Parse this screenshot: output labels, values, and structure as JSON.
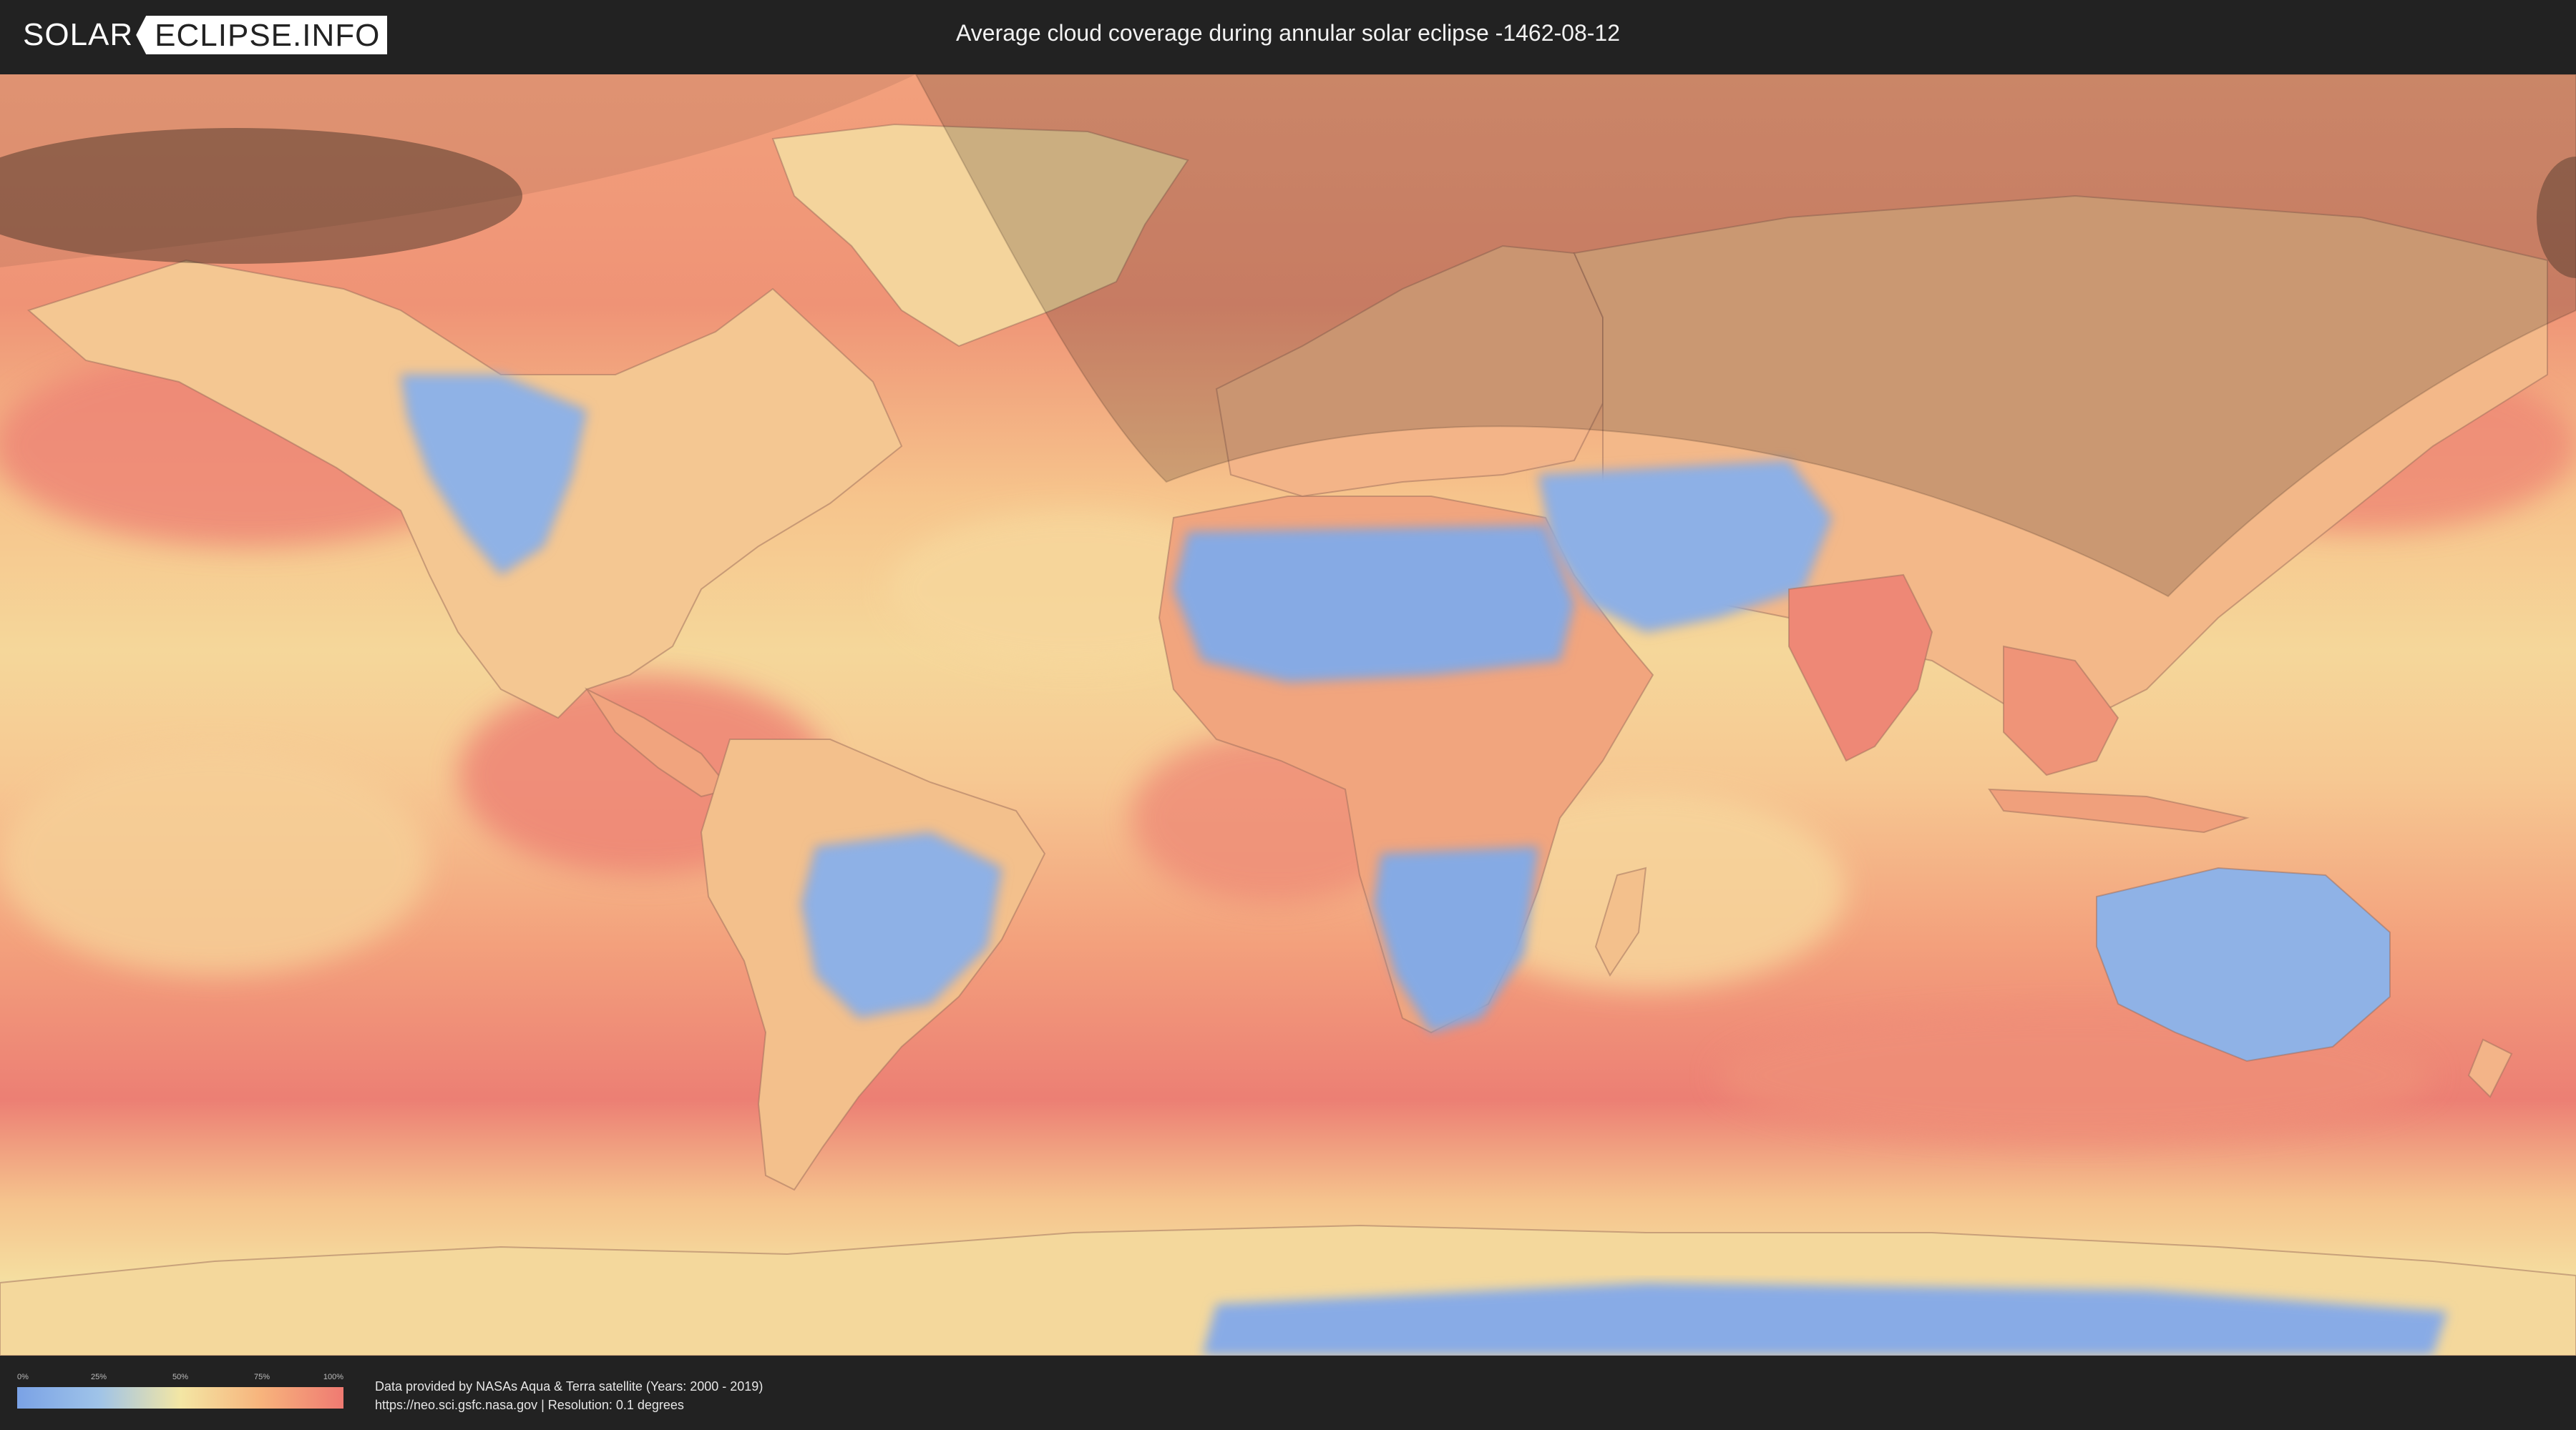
{
  "header": {
    "logo_left": "SOLAR",
    "logo_right": "ECLIPSE.INFO",
    "title": "Average cloud coverage during annular solar eclipse -1462-08-12"
  },
  "map": {
    "colors": {
      "ocean_cloudy": "#ef8a76",
      "mid": "#f7b882",
      "light": "#f4dfa0",
      "clear": "#84a9e4",
      "eclipse_shadow": "#3a2a20"
    },
    "features": [
      "north-america",
      "south-america",
      "africa",
      "europe",
      "asia",
      "australia",
      "antarctica",
      "greenland",
      "eclipse-path-band",
      "eclipse-ellipse"
    ]
  },
  "legend": {
    "ticks": [
      "0%",
      "25%",
      "50%",
      "75%",
      "100%"
    ],
    "colors": [
      "#7aa2e6",
      "#9fc3e8",
      "#f3e6a4",
      "#f7b37c",
      "#ef7a72"
    ]
  },
  "credits": {
    "line1": "Data provided by NASAs Aqua & Terra satellite (Years: 2000 - 2019)",
    "line2": "https://neo.sci.gsfc.nasa.gov | Resolution: 0.1 degrees"
  }
}
